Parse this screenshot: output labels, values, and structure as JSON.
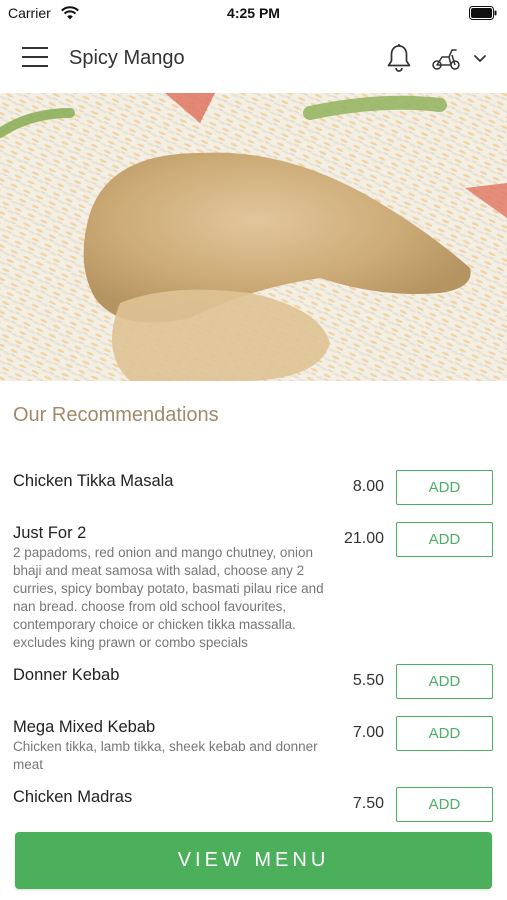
{
  "status_bar": {
    "carrier": "Carrier",
    "time": "4:25 PM"
  },
  "header": {
    "title": "Spicy Mango",
    "icons": [
      "menu-icon",
      "bell-icon",
      "scooter-icon",
      "chevron-down-icon"
    ]
  },
  "hero": {
    "image": "chicken biryani photo"
  },
  "recommendations": {
    "title": "Our Recommendations",
    "items": [
      {
        "name": "Chicken Tikka Masala",
        "description": "",
        "price": "8.00",
        "button": "ADD"
      },
      {
        "name": "Just For 2",
        "description": "2 papadoms, red onion and mango chutney, onion bhaji and meat samosa with salad, choose any 2 curries, spicy bombay potato, basmati pilau rice and nan bread. choose from old school favourites, contemporary choice or chicken tikka massalla. excludes king prawn or combo specials",
        "price": "21.00",
        "button": "ADD"
      },
      {
        "name": "Donner Kebab",
        "description": "",
        "price": "5.50",
        "button": "ADD"
      },
      {
        "name": "Mega Mixed Kebab",
        "description": "Chicken tikka, lamb tikka, sheek kebab and donner meat",
        "price": "7.00",
        "button": "ADD"
      },
      {
        "name": "Chicken Madras",
        "description": "",
        "price": "7.50",
        "button": "ADD"
      }
    ]
  },
  "footer": {
    "view_menu_label": "VIEW MENU"
  },
  "colors": {
    "accent_green": "#4caf5b",
    "section_title": "#a08a6a"
  }
}
